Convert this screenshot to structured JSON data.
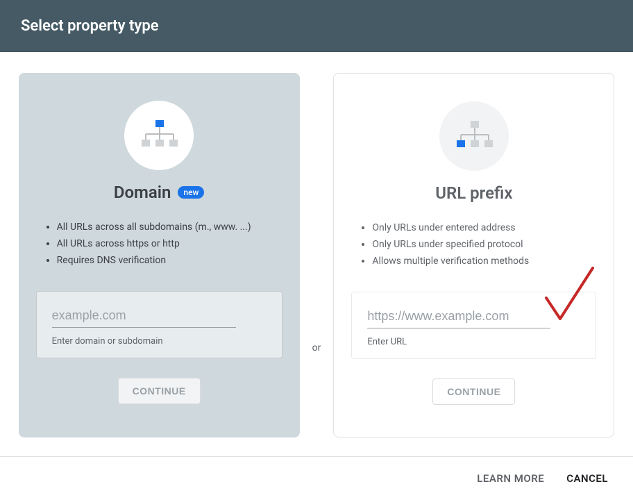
{
  "header": {
    "title": "Select property type"
  },
  "divider": {
    "label": "or"
  },
  "domain_card": {
    "title": "Domain",
    "badge": "new",
    "bullets": [
      "All URLs across all subdomains (m., www. ...)",
      "All URLs across https or http",
      "Requires DNS verification"
    ],
    "input_placeholder": "example.com",
    "helper": "Enter domain or subdomain",
    "continue": "CONTINUE"
  },
  "url_card": {
    "title": "URL prefix",
    "bullets": [
      "Only URLs under entered address",
      "Only URLs under specified protocol",
      "Allows multiple verification methods"
    ],
    "input_placeholder": "https://www.example.com",
    "helper": "Enter URL",
    "continue": "CONTINUE"
  },
  "footer": {
    "learn_more": "LEARN MORE",
    "cancel": "CANCEL"
  },
  "icons": {
    "sitemap_domain": {
      "highlight": "top"
    },
    "sitemap_url": {
      "highlight": "bottom-left"
    }
  },
  "annotation": {
    "checkmark_color": "#c62828"
  }
}
